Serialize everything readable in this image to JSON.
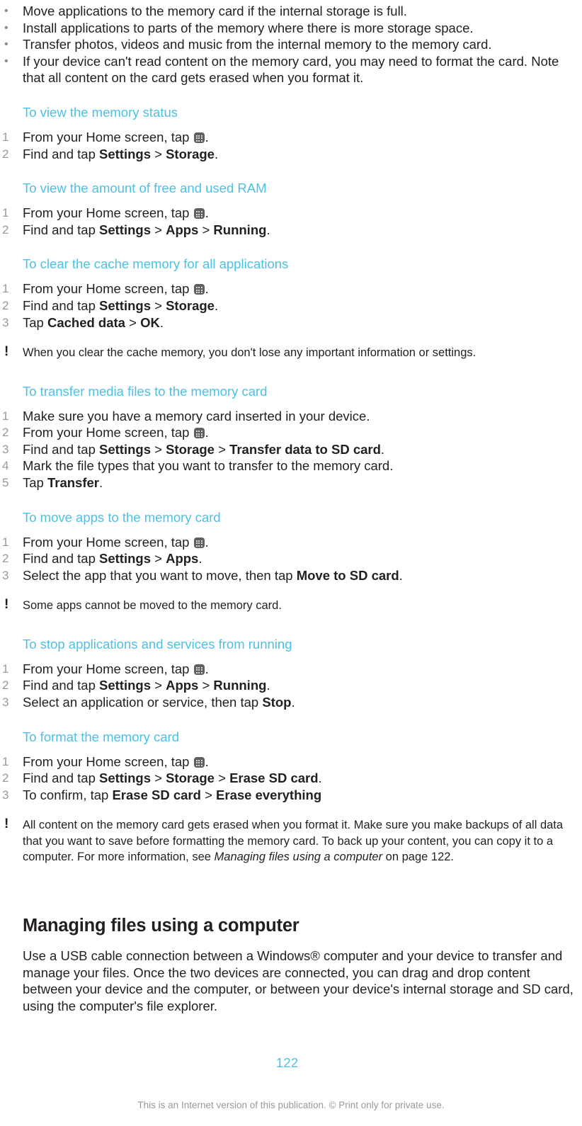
{
  "document": {
    "page_number": "122",
    "footer_note": "This is an Internet version of this publication. © Print only for private use.",
    "accent_color": "#4cc1e6",
    "text_color": "#231f20",
    "marker_color": "#9a9a9a"
  },
  "intro_bullets": [
    {
      "marker": "•",
      "text": "Move applications to the memory card if the internal storage is full."
    },
    {
      "marker": "•",
      "text": "Install applications to parts of the memory where there is more storage space."
    },
    {
      "marker": "•",
      "text": "Transfer photos, videos and music from the internal memory to the memory card."
    },
    {
      "marker": "•",
      "text": "If your device can't read content on the memory card, you may need to format the card. Note that all content on the card gets erased when you format it."
    }
  ],
  "sections": [
    {
      "heading": "To view the memory status",
      "steps": [
        {
          "num": "1",
          "pre": "From your Home screen, tap ",
          "icon": "app-drawer-icon",
          "post": "."
        },
        {
          "num": "2",
          "pre": "Find and tap ",
          "bold_path": [
            "Settings",
            "Storage"
          ],
          "post": "."
        }
      ]
    },
    {
      "heading": "To view the amount of free and used RAM",
      "steps": [
        {
          "num": "1",
          "pre": "From your Home screen, tap ",
          "icon": "app-drawer-icon",
          "post": "."
        },
        {
          "num": "2",
          "pre": "Find and tap ",
          "bold_path": [
            "Settings",
            "Apps",
            "Running"
          ],
          "post": "."
        }
      ]
    },
    {
      "heading": "To clear the cache memory for all applications",
      "steps": [
        {
          "num": "1",
          "pre": "From your Home screen, tap ",
          "icon": "app-drawer-icon",
          "post": "."
        },
        {
          "num": "2",
          "pre": "Find and tap ",
          "bold_path": [
            "Settings",
            "Storage"
          ],
          "post": "."
        },
        {
          "num": "3",
          "pre": "Tap ",
          "bold_path": [
            "Cached data",
            "OK"
          ],
          "post": "."
        }
      ],
      "note": {
        "marker": "!",
        "text": "When you clear the cache memory, you don't lose any important information or settings."
      }
    },
    {
      "heading": "To transfer media files to the memory card",
      "steps": [
        {
          "num": "1",
          "pre": "Make sure you have a memory card inserted in your device.",
          "bold_path": [],
          "post": ""
        },
        {
          "num": "2",
          "pre": "From your Home screen, tap ",
          "icon": "app-drawer-icon",
          "post": "."
        },
        {
          "num": "3",
          "pre": "Find and tap ",
          "bold_path": [
            "Settings",
            "Storage",
            "Transfer data to SD card"
          ],
          "post": "."
        },
        {
          "num": "4",
          "pre": "Mark the file types that you want to transfer to the memory card.",
          "bold_path": [],
          "post": ""
        },
        {
          "num": "5",
          "pre": "Tap ",
          "bold_path": [
            "Transfer"
          ],
          "post": "."
        }
      ]
    },
    {
      "heading": "To move apps to the memory card",
      "steps": [
        {
          "num": "1",
          "pre": "From your Home screen, tap ",
          "icon": "app-drawer-icon",
          "post": "."
        },
        {
          "num": "2",
          "pre": "Find and tap ",
          "bold_path": [
            "Settings",
            "Apps"
          ],
          "post": "."
        },
        {
          "num": "3",
          "pre": "Select the app that you want to move, then tap ",
          "bold_path": [
            "Move to SD card"
          ],
          "post": "."
        }
      ],
      "note": {
        "marker": "!",
        "text": "Some apps cannot be moved to the memory card."
      }
    },
    {
      "heading": "To stop applications and services from running",
      "steps": [
        {
          "num": "1",
          "pre": "From your Home screen, tap ",
          "icon": "app-drawer-icon",
          "post": "."
        },
        {
          "num": "2",
          "pre": "Find and tap ",
          "bold_path": [
            "Settings",
            "Apps",
            "Running"
          ],
          "post": "."
        },
        {
          "num": "3",
          "pre": "Select an application or service, then tap ",
          "bold_path": [
            "Stop"
          ],
          "post": "."
        }
      ]
    },
    {
      "heading": "To format the memory card",
      "steps": [
        {
          "num": "1",
          "pre": "From your Home screen, tap ",
          "icon": "app-drawer-icon",
          "post": "."
        },
        {
          "num": "2",
          "pre": "Find and tap ",
          "bold_path": [
            "Settings",
            "Storage",
            "Erase SD card"
          ],
          "post": "."
        },
        {
          "num": "3",
          "pre": "To confirm, tap ",
          "bold_path": [
            "Erase SD card",
            "Erase everything"
          ],
          "post": ""
        }
      ],
      "note": {
        "marker": "!",
        "text_part1": "All content on the memory card gets erased when you format it. Make sure you make backups of all data that you want to save before formatting the memory card. To back up your content, you can copy it to a computer. For more information, see ",
        "italic_ref": "Managing files using a computer",
        "text_part2": " on page 122."
      }
    }
  ],
  "chapter": {
    "title": "Managing files using a computer",
    "paragraph": "Use a USB cable connection between a Windows® computer and your device to transfer and manage your files. Once the two devices are connected, you can drag and drop content between your device and the computer, or between your device's internal storage and SD card, using the computer's file explorer."
  }
}
